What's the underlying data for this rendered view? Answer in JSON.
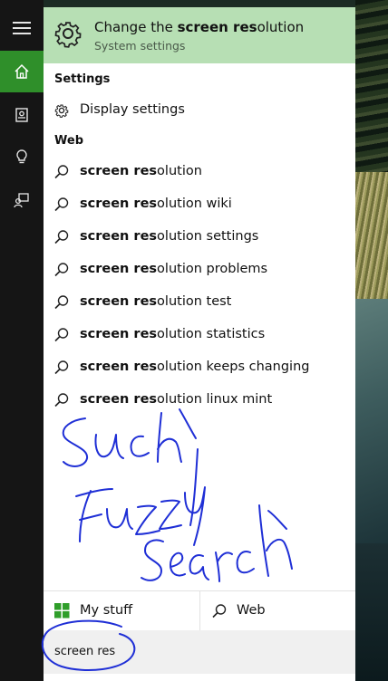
{
  "best_match": {
    "title_prefix": "Change the ",
    "title_bold": "screen res",
    "title_suffix": "olution",
    "subtitle": "System settings"
  },
  "sections": {
    "settings_heading": "Settings",
    "web_heading": "Web"
  },
  "settings_results": [
    {
      "label": "Display settings",
      "icon": "gear-icon"
    }
  ],
  "web_results": [
    {
      "bold": "screen res",
      "rest": "olution"
    },
    {
      "bold": "screen res",
      "rest": "olution wiki"
    },
    {
      "bold": "screen res",
      "rest": "olution settings"
    },
    {
      "bold": "screen res",
      "rest": "olution problems"
    },
    {
      "bold": "screen res",
      "rest": "olution test"
    },
    {
      "bold": "screen res",
      "rest": "olution statistics"
    },
    {
      "bold": "screen res",
      "rest": "olution keeps changing"
    },
    {
      "bold": "screen res",
      "rest": "olution linux mint"
    }
  ],
  "annotation": {
    "text": "Such Fuzzy Search",
    "color": "#1f2fd6"
  },
  "tabs": {
    "mystuff_label": "My stuff",
    "web_label": "Web"
  },
  "search": {
    "value": "screen res"
  },
  "colors": {
    "accent": "#2f8f2a",
    "best_match_bg": "#b7dfb4",
    "rail_bg": "#151515",
    "ink": "#1f2fd6"
  }
}
